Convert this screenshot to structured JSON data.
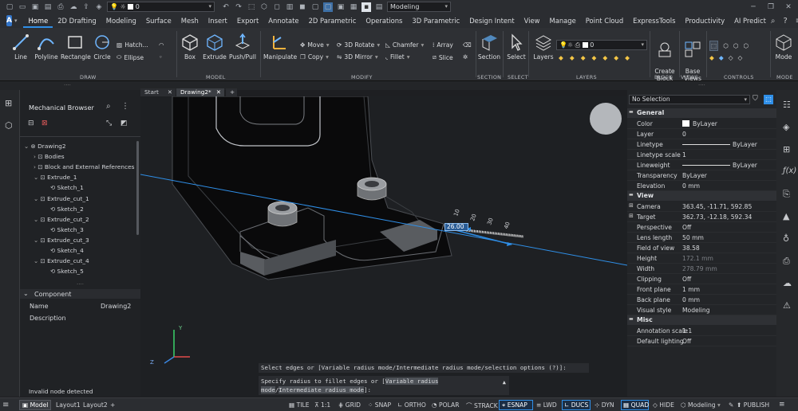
{
  "qat": {
    "layer_value": "0",
    "workspace": "Modeling"
  },
  "menu": {
    "tabs": [
      "Home",
      "2D Drafting",
      "Modeling",
      "Surface",
      "Mesh",
      "Insert",
      "Export",
      "Annotate",
      "2D Parametric",
      "Operations",
      "3D Parametric",
      "Design Intent",
      "View",
      "Manage",
      "Point Cloud",
      "ExpressTools",
      "Productivity",
      "AI Predict"
    ]
  },
  "ribbon": {
    "draw": {
      "line": "Line",
      "polyline": "Polyline",
      "rectangle": "Rectangle",
      "circle": "Circle",
      "hatch": "Hatch...",
      "ellipse": "Ellipse",
      "panel": "DRAW"
    },
    "model": {
      "box": "Box",
      "extrude": "Extrude",
      "pushpull": "Push/Pull",
      "panel": "MODEL"
    },
    "modify": {
      "manipulate": "Manipulate",
      "move": "Move",
      "copy": "Copy",
      "rotate3d": "3D Rotate",
      "mirror3d": "3D Mirror",
      "chamfer": "Chamfer",
      "fillet": "Fillet",
      "array": "Array",
      "slice": "Slice",
      "panel": "MODIFY"
    },
    "section": {
      "label": "Section",
      "panel": "SECTION"
    },
    "select": {
      "label": "Select",
      "panel": "SELECT"
    },
    "layers": {
      "label": "Layers",
      "combo": "0",
      "panel": "LAYERS"
    },
    "block": {
      "create": "Create\nBlock",
      "panel": "BLOCK"
    },
    "views": {
      "base": "Base\nViews",
      "panel": "VIEWS"
    },
    "controls": {
      "panel": "CONTROLS"
    },
    "mode": {
      "label": "Mode",
      "panel": "MODE"
    }
  },
  "doc_tabs": {
    "start": "Start",
    "drawing": "Drawing2*"
  },
  "browser": {
    "title": "Mechanical Browser",
    "items": [
      {
        "label": "Drawing2",
        "level": 0
      },
      {
        "label": "Bodies",
        "level": 1
      },
      {
        "label": "Block and External References",
        "level": 1
      },
      {
        "label": "Extrude_1",
        "level": 1
      },
      {
        "label": "Sketch_1",
        "level": 2
      },
      {
        "label": "Extrude_cut_1",
        "level": 1
      },
      {
        "label": "Sketch_2",
        "level": 2
      },
      {
        "label": "Extrude_cut_2",
        "level": 1
      },
      {
        "label": "Sketch_3",
        "level": 2
      },
      {
        "label": "Extrude_cut_3",
        "level": 1
      },
      {
        "label": "Sketch_4",
        "level": 2
      },
      {
        "label": "Extrude_cut_4",
        "level": 1
      },
      {
        "label": "Sketch_5",
        "level": 2
      }
    ],
    "component_header": "Component",
    "comp_name_key": "Name",
    "comp_name_val": "Drawing2",
    "comp_desc_key": "Description",
    "status_msg": "Invalid node detected"
  },
  "viewport": {
    "dimension_value": "26.00",
    "ticks": [
      "10",
      "20",
      "30",
      "40"
    ],
    "axis_y": "Y",
    "axis_z": "Z"
  },
  "command": {
    "prompt1": "Select edges or [Variable radius mode/Intermediate radius mode/selection options (?)]:",
    "prompt2_a": "Specify radius to fillet edges or [",
    "prompt2_opt1": "Variable radius",
    "prompt2_opt1_b": "mode",
    "prompt2_slash": "/",
    "prompt2_opt2": "Intermediate radius mode",
    "prompt2_end": "]:"
  },
  "properties": {
    "selection": "No Selection",
    "general_header": "General",
    "general": [
      {
        "k": "Color",
        "v": "ByLayer"
      },
      {
        "k": "Layer",
        "v": "0"
      },
      {
        "k": "Linetype",
        "v": "ByLayer"
      },
      {
        "k": "Linetype scale",
        "v": "1"
      },
      {
        "k": "Lineweight",
        "v": "ByLayer"
      },
      {
        "k": "Transparency",
        "v": "ByLayer"
      },
      {
        "k": "Elevation",
        "v": "0 mm"
      }
    ],
    "view_header": "View",
    "view": [
      {
        "k": "Camera",
        "v": "363.45, -11.71, 592.85"
      },
      {
        "k": "Target",
        "v": "362.73, -12.18, 592.34"
      },
      {
        "k": "Perspective",
        "v": "Off"
      },
      {
        "k": "Lens length",
        "v": "50 mm"
      },
      {
        "k": "Field of view",
        "v": "38.58"
      },
      {
        "k": "Height",
        "v": "172.1 mm"
      },
      {
        "k": "Width",
        "v": "278.79 mm"
      },
      {
        "k": "Clipping",
        "v": "Off"
      },
      {
        "k": "Front plane",
        "v": "1 mm"
      },
      {
        "k": "Back plane",
        "v": "0 mm"
      },
      {
        "k": "Visual style",
        "v": "Modeling"
      }
    ],
    "misc_header": "Misc",
    "misc": [
      {
        "k": "Annotation scale",
        "v": "1:1"
      },
      {
        "k": "Default lighting",
        "v": "Off"
      }
    ]
  },
  "status": {
    "model": "Model",
    "layout1": "Layout1",
    "layout2": "Layout2",
    "tile": "TILE",
    "scale": "1:1",
    "grid": "GRID",
    "snap": "SNAP",
    "ortho": "ORTHO",
    "polar": "POLAR",
    "strack": "STRACK",
    "esnap": "ESNAP",
    "lwd": "LWD",
    "ducs": "DUCS",
    "dyn": "DYN",
    "quad": "QUAD",
    "hide": "HIDE",
    "modeling": "Modeling",
    "publish": "PUBLISH"
  },
  "colors": {
    "accent": "#2f8fe8",
    "panel": "#2e3034",
    "bg": "#1e1f22"
  }
}
